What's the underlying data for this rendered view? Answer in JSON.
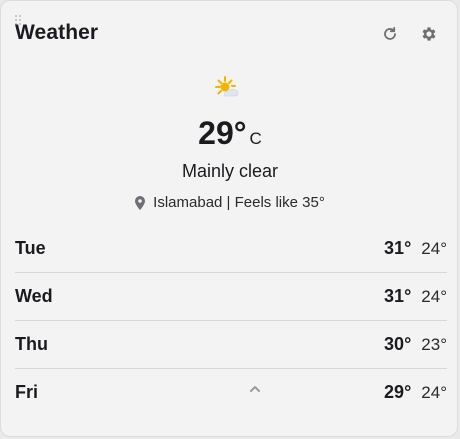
{
  "header": {
    "title": "Weather",
    "refresh_icon": "refresh-icon",
    "settings_icon": "gear-icon"
  },
  "current": {
    "icon": "partly-sunny-icon",
    "temperature": "29°",
    "unit": "C",
    "condition": "Mainly clear",
    "location_line": "Islamabad | Feels like 35°"
  },
  "forecast": [
    {
      "day": "Tue",
      "high": "31°",
      "low": "24°"
    },
    {
      "day": "Wed",
      "high": "31°",
      "low": "24°"
    },
    {
      "day": "Thu",
      "high": "30°",
      "low": "23°"
    },
    {
      "day": "Fri",
      "high": "29°",
      "low": "24°"
    }
  ],
  "colors": {
    "background": "#f3f3f4",
    "text": "#1b1b1f",
    "divider": "#d7d7da",
    "sun": "#f5b400",
    "icon": "#6e6e73"
  }
}
